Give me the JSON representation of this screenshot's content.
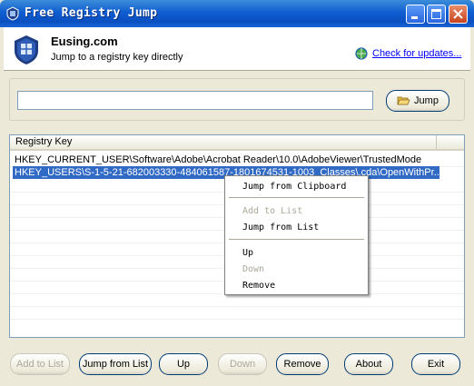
{
  "window": {
    "title": "Free Registry Jump"
  },
  "header": {
    "brand": "Eusing.com",
    "subtitle": "Jump to a registry key directly",
    "update_link": "Check for updates..."
  },
  "input": {
    "value": "",
    "jump_label": "Jump"
  },
  "list": {
    "column_header": "Registry Key",
    "rows": [
      "HKEY_CURRENT_USER\\Software\\Adobe\\Acrobat Reader\\10.0\\AdobeViewer\\TrustedMode",
      "HKEY_USERS\\S-1-5-21-682003330-484061587-1801674531-1003_Classes\\.cda\\OpenWithPr..."
    ],
    "selected_index": 1
  },
  "context_menu": {
    "items": [
      {
        "label": "Jump from Clipboard",
        "enabled": true
      },
      {
        "label": "Add to List",
        "enabled": false
      },
      {
        "label": "Jump from List",
        "enabled": true
      },
      {
        "label": "Up",
        "enabled": true
      },
      {
        "label": "Down",
        "enabled": false
      },
      {
        "label": "Remove",
        "enabled": true
      }
    ]
  },
  "buttons": {
    "add_to_list": "Add to List",
    "jump_from_list": "Jump from List",
    "up": "Up",
    "down": "Down",
    "remove": "Remove",
    "about": "About",
    "exit": "Exit"
  },
  "colors": {
    "title_bar": "#0f5dd1",
    "selection": "#316ac5",
    "link": "#0000ff"
  },
  "icons": {
    "app": "registry-shield-icon",
    "update": "globe-refresh-icon",
    "jump": "folder-open-icon"
  }
}
